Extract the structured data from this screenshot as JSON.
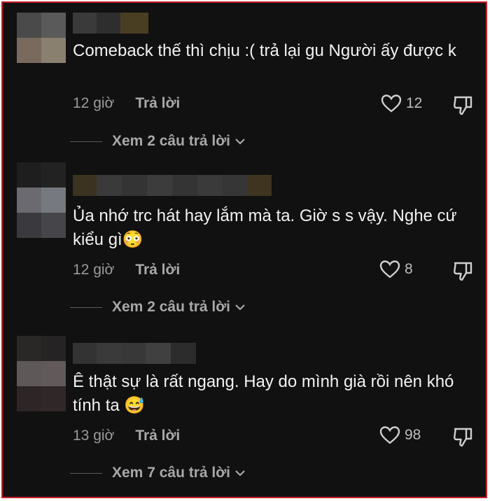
{
  "comments": [
    {
      "avatar_colors": [
        "#4a4a4a",
        "#5a5a5a",
        "#7a6a5e",
        "#8a8070"
      ],
      "username_colors": [
        "#3a3a3a",
        "#2e2e2e",
        "#3b3525",
        "#4a3e22"
      ],
      "text": "Comeback thế thì chịu :( trả lại gu Người ấy được k",
      "time": "12 giờ",
      "reply_label": "Trả lời",
      "likes": "12",
      "view_replies": "Xem 2 câu trả lời"
    },
    {
      "avatar_colors": [
        "#1e1e1e",
        "#222222",
        "#6a6a70",
        "#767a80",
        "#3a3a3e",
        "#45454a"
      ],
      "username_colors": [
        "#3b3220",
        "#3a3a3a",
        "#343434",
        "#3c3c3c",
        "#343434",
        "#3a3a3a",
        "#363636",
        "#3e3420"
      ],
      "text": "Ủa nhớ trc hát hay lắm mà ta. Giờ s s vậy. Nghe cứ kiểu gì😳",
      "time": "12 giờ",
      "reply_label": "Trả lời",
      "likes": "8",
      "view_replies": "Xem 2 câu trả lời"
    },
    {
      "avatar_colors": [
        "#2a2727",
        "#252323",
        "#5e5858",
        "#625a5a",
        "#2e2626",
        "#302828"
      ],
      "username_colors": [
        "#333333",
        "#3a3a3a",
        "#383838",
        "#404040",
        "#2c2c2c"
      ],
      "text": "Ê thật sự là rất ngang. Hay do mình già rồi nên khó tính ta 😅",
      "time": "13 giờ",
      "reply_label": "Trả lời",
      "likes": "98",
      "view_replies": "Xem 7 câu trả lời"
    }
  ]
}
